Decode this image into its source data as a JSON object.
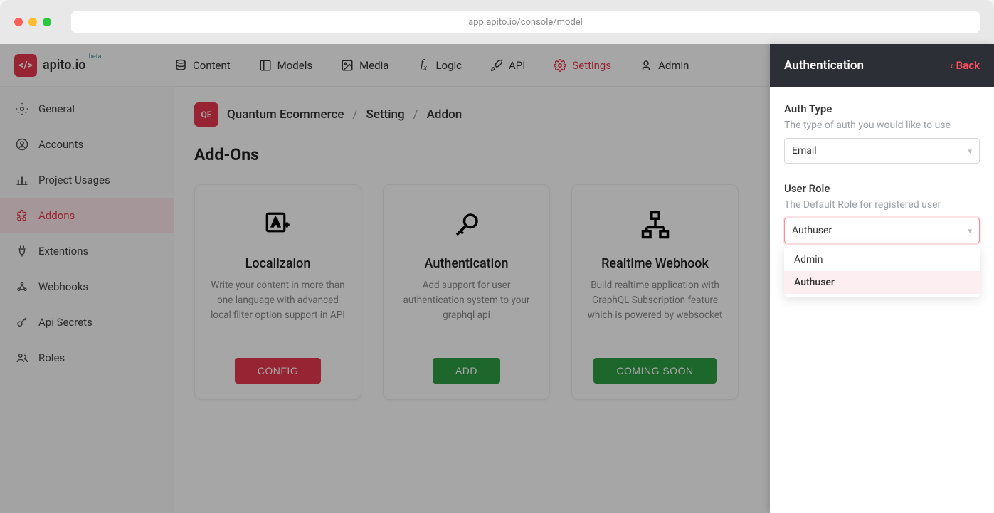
{
  "browser": {
    "url": "app.apito.io/console/model"
  },
  "logo": {
    "text": "apito.io",
    "badge": "beta"
  },
  "topnav": {
    "content": "Content",
    "models": "Models",
    "media": "Media",
    "logic": "Logic",
    "api": "API",
    "settings": "Settings",
    "admin": "Admin"
  },
  "sidebar": {
    "general": "General",
    "accounts": "Accounts",
    "usages": "Project Usages",
    "addons": "Addons",
    "extentions": "Extentions",
    "webhooks": "Webhooks",
    "secrets": "Api Secrets",
    "roles": "Roles"
  },
  "breadcrumb": {
    "project_short": "QE",
    "project": "Quantum Ecommerce",
    "setting": "Setting",
    "addon": "Addon"
  },
  "section": {
    "title": "Add-Ons"
  },
  "cards": {
    "localization": {
      "title": "Localizaion",
      "desc": "Write your content in more than one language with advanced local filter option support in API",
      "btn": "CONFIG"
    },
    "authentication": {
      "title": "Authentication",
      "desc": "Add support for user authentication system to your graphql api",
      "btn": "ADD"
    },
    "webhook": {
      "title": "Realtime Webhook",
      "desc": "Build realtime application with GraphQL Subscription feature which is powered by websocket",
      "btn": "COMING SOON"
    }
  },
  "panel": {
    "title": "Authentication",
    "back": "Back",
    "auth_type": {
      "label": "Auth Type",
      "hint": "The type of auth you would like to use",
      "value": "Email"
    },
    "user_role": {
      "label": "User Role",
      "hint": "The Default Role for registered user",
      "value": "Authuser",
      "options": {
        "admin": "Admin",
        "authuser": "Authuser"
      }
    }
  }
}
